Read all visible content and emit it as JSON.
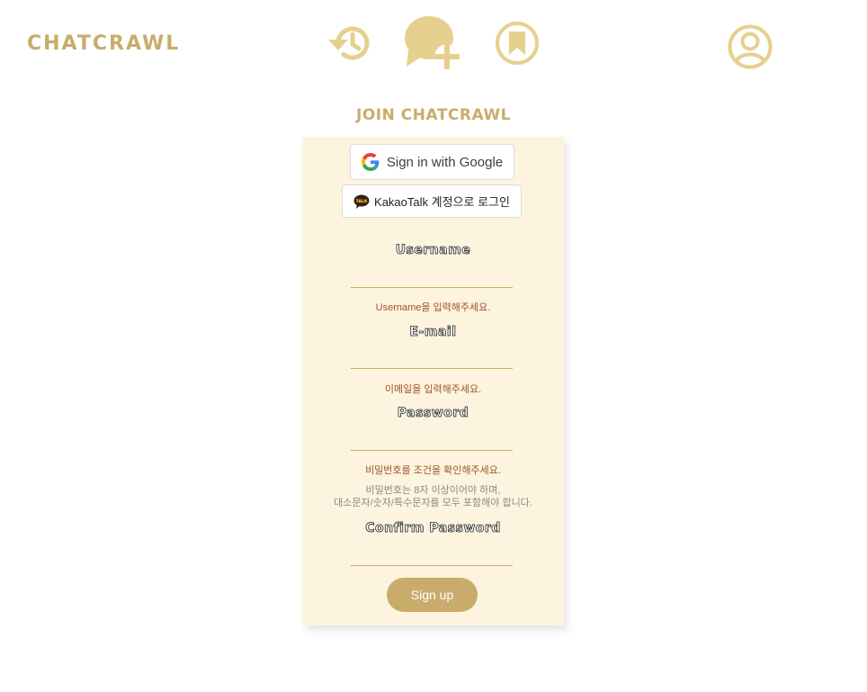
{
  "header": {
    "logo": "CHATCRAWL",
    "icons": [
      "history-icon",
      "new-chat-icon",
      "bookmark-icon",
      "profile-icon"
    ]
  },
  "colors": {
    "accent": "#c9ac6b",
    "icon": "#e7cf8d",
    "card_bg": "#fcf4de",
    "error": "#a0522d"
  },
  "page": {
    "title": "JOIN CHATCRAWL"
  },
  "social": {
    "google_label": "Sign in with Google",
    "kakao_label": "KakaoTalk 계정으로 로그인",
    "kakao_badge": "TALK"
  },
  "form": {
    "username": {
      "label": "Username",
      "value": "",
      "error": "Username을 입력해주세요."
    },
    "email": {
      "label": "E-mail",
      "value": "",
      "error": "이메일을 입력해주세요."
    },
    "password": {
      "label": "Password",
      "value": "",
      "error": "비밀번호를 조건을 확인해주세요.",
      "hint_line1": "비밀번호는 8자 이상이어야 하며,",
      "hint_line2": "대소문자/숫자/특수문자를 모두 포함해야 합니다."
    },
    "confirm_password": {
      "label": "Confirm Password",
      "value": ""
    },
    "submit_label": "Sign up"
  }
}
